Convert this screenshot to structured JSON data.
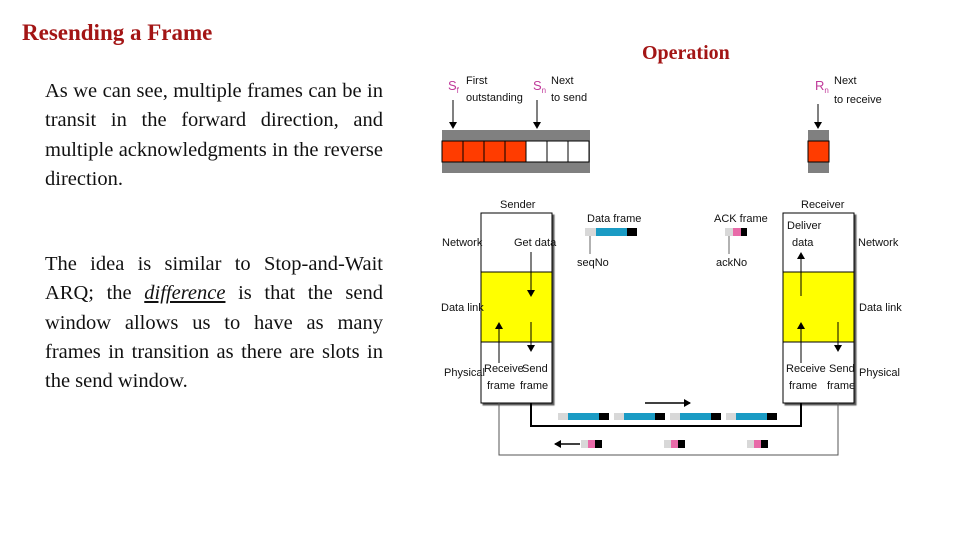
{
  "slide": {
    "title": "Resending a Frame",
    "diagram_title": "Operation",
    "paragraph1": "As we can see, multiple frames can be in transit in the forward direction, and multiple acknowledgments in the reverse direction.",
    "paragraph2": {
      "before": "The idea is similar to Stop-and-Wait ARQ; the ",
      "emphasis": "difference",
      "after": " is that the send window allows us to have as many frames in transition as there are slots in the send window."
    }
  },
  "diagram": {
    "send_window": {
      "sf_symbol": "S",
      "sf_sub": "f",
      "sf_label_line1": "First",
      "sf_label_line2": "outstanding",
      "sn_symbol": "S",
      "sn_sub": "n",
      "sn_label_line1": "Next",
      "sn_label_line2": "to send",
      "outstanding_slots": 4,
      "empty_slots": 3
    },
    "receive_window": {
      "rn_symbol": "R",
      "rn_sub": "n",
      "label_line1": "Next",
      "label_line2": "to receive",
      "slots": 1
    },
    "sender": {
      "title": "Sender",
      "get_data": "Get data",
      "receive_frame_1": "Receive",
      "receive_frame_2": "frame",
      "send_frame_1": "Send",
      "send_frame_2": "frame"
    },
    "receiver": {
      "title": "Receiver",
      "deliver_1": "Deliver",
      "deliver_2": "data",
      "receive_frame_1": "Receive",
      "receive_frame_2": "frame",
      "send_frame_1": "Send",
      "send_frame_2": "frame"
    },
    "layers": {
      "network": "Network",
      "data_link": "Data link",
      "physical": "Physical"
    },
    "legend": {
      "data_frame": "Data frame",
      "seq_no": "seqNo",
      "ack_frame": "ACK frame",
      "ack_no": "ackNo"
    },
    "data_frames_in_transit": 4,
    "ack_frames_in_transit": 3,
    "colors": {
      "outstanding": "#ff3c00",
      "window_border": "#808080",
      "data_link_layer": "#ffff00",
      "frame_body": "#1a9bc4",
      "ack_body": "#e86aa8",
      "title": "#a31515"
    }
  }
}
